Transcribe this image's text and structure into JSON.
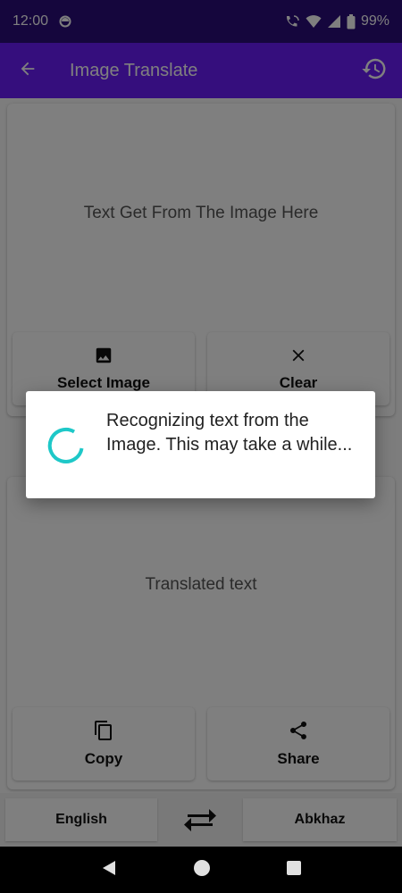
{
  "status_bar": {
    "time": "12:00",
    "battery": "99%"
  },
  "app_bar": {
    "title": "Image Translate",
    "back_icon": "arrow-left-icon",
    "history_icon": "history-icon"
  },
  "source_card": {
    "placeholder": "Text Get From The Image Here",
    "buttons": [
      {
        "label": "Select Image",
        "icon": "image-icon"
      },
      {
        "label": "Clear",
        "icon": "close-icon"
      }
    ]
  },
  "result_card": {
    "placeholder": "Translated text",
    "buttons": [
      {
        "label": "Copy",
        "icon": "copy-icon"
      },
      {
        "label": "Share",
        "icon": "share-icon"
      }
    ]
  },
  "language_bar": {
    "source_language": "English",
    "target_language": "Abkhaz",
    "swap_icon": "swap-arrows-icon"
  },
  "dialog": {
    "message": "Recognizing text from the Image. This may take a while..."
  },
  "colors": {
    "status_bar": "#2a0d7a",
    "app_bar": "#6a1dfa",
    "spinner": "#1ec8c8",
    "scrim": "rgba(0,0,0,0.5)"
  }
}
